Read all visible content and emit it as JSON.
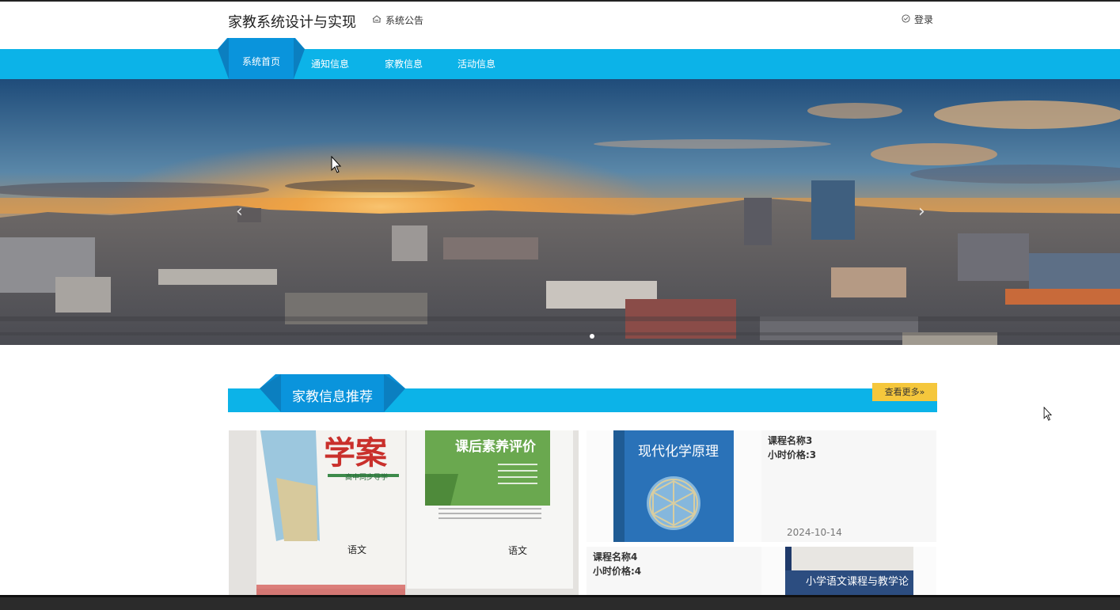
{
  "header": {
    "site_title": "家教系统设计与实现",
    "notice_label": "系统公告",
    "login_label": "登录"
  },
  "nav": {
    "items": [
      "系统首页",
      "通知信息",
      "家教信息",
      "活动信息"
    ],
    "active_index": 0
  },
  "banner": {
    "prev_arrow": "‹",
    "next_arrow": "›",
    "slide_count": 1,
    "active_slide": 0
  },
  "section": {
    "title": "家教信息推荐",
    "more_label": "查看更多»"
  },
  "cards": [
    {
      "name": "课程名称3",
      "price": "小时价格:3",
      "date": "2024-10-14",
      "cover_title": "现代化学原理"
    },
    {
      "name": "课程名称4",
      "price": "小时价格:4",
      "cover_title": "小学语文课程与教学论"
    }
  ],
  "big_card": {
    "book1_title": "学案",
    "book1_sub": "高中同步导学",
    "book1_subject": "语文",
    "book2_title": "课后素养评价",
    "book2_subject": "语文"
  },
  "colors": {
    "nav_blue": "#0cb3e8",
    "tab_blue": "#0a8fd6",
    "more_yellow": "#f5c73c"
  }
}
